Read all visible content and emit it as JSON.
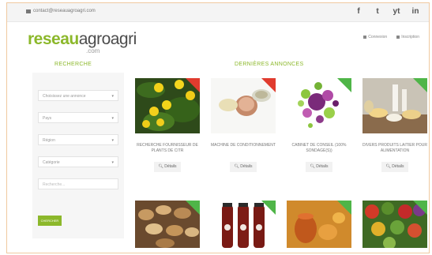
{
  "topbar": {
    "email": "contact@reseauagroagri.com",
    "social": [
      "f",
      "t",
      "yt",
      "in"
    ]
  },
  "logo": {
    "part_a": "reseau",
    "part_b": "agroagri",
    "suffix": ".com"
  },
  "account": {
    "connexion": "Connexion",
    "inscription": "Inscription"
  },
  "sidebar": {
    "title": "RECHERCHE",
    "selects": [
      "Choisissez une annonce",
      "Pays",
      "Région",
      "Catégorie"
    ],
    "input_placeholder": "Recherche...",
    "search_button": "CHERCHER"
  },
  "main": {
    "title": "DERNIÈRES ANNONCES",
    "details_label": "Détails",
    "cards": [
      {
        "title": "RECHERCHE FOURNISSEUR DE PLANTS DE CITR",
        "tag_color": "#e03b2e"
      },
      {
        "title": "MACHINE DE CONDITIONNEMENT",
        "tag_color": "#e03b2e"
      },
      {
        "title": "CABINET DE CONSEIL (100% SONDAGE(S))",
        "tag_color": "#4fb548"
      },
      {
        "title": "DIVERS PRODUITS LAITIER POUR ALIMENTATION",
        "tag_color": "#4fb548"
      }
    ],
    "row2_tag_colors": [
      "#4fb548",
      "#4fb548",
      "#4fb548",
      "#4fb548"
    ]
  },
  "colors": {
    "accent": "#8cb82b",
    "offer": "#4fb548",
    "request": "#e03b2e"
  }
}
